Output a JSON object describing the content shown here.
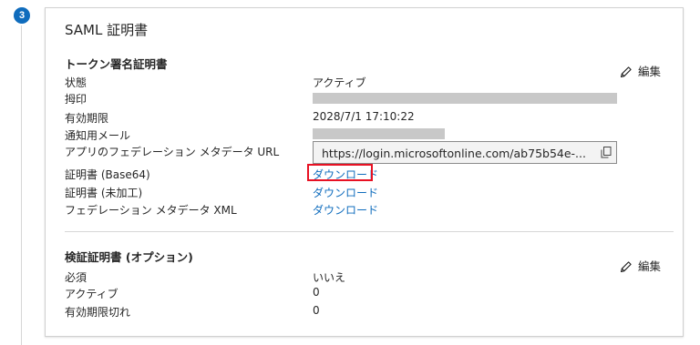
{
  "step": {
    "number": "3"
  },
  "card": {
    "title": "SAML 証明書"
  },
  "token_section": {
    "title": "トークン署名証明書",
    "edit_label": "編集",
    "rows": {
      "status": {
        "label": "状態",
        "value": "アクティブ"
      },
      "thumbprint": {
        "label": "拇印"
      },
      "expiration": {
        "label": "有効期限",
        "value": "2028/7/1 17:10:22"
      },
      "notification_email": {
        "label": "通知用メール"
      },
      "metadata_url": {
        "label": "アプリのフェデレーション メタデータ URL",
        "value": "https://login.microsoftonline.com/ab75b54e-..."
      },
      "cert_base64": {
        "label": "証明書 (Base64)",
        "link": "ダウンロード"
      },
      "cert_raw": {
        "label": "証明書 (未加工)",
        "link": "ダウンロード"
      },
      "federation_xml": {
        "label": "フェデレーション メタデータ XML",
        "link": "ダウンロード"
      }
    }
  },
  "verification_section": {
    "title": "検証証明書 (オプション)",
    "edit_label": "編集",
    "rows": {
      "required": {
        "label": "必須",
        "value": "いいえ"
      },
      "active": {
        "label": "アクティブ",
        "value": "0"
      },
      "expired": {
        "label": "有効期限切れ",
        "value": "0"
      }
    }
  },
  "colors": {
    "accent": "#0f6cbd",
    "highlight": "#e81123",
    "redaction": "#c8c8c8"
  }
}
